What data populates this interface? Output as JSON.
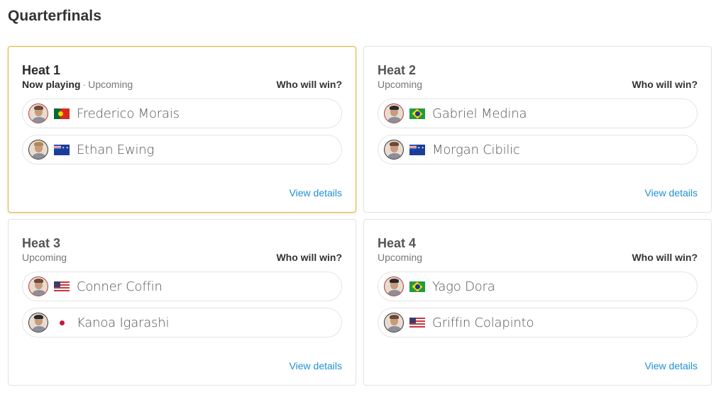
{
  "page": {
    "title": "Quarterfinals"
  },
  "who_label": "Who will win?",
  "view_details_label": "View details",
  "colors": {
    "active_border": "#e3b62e",
    "link": "#1e90d8"
  },
  "heats": [
    {
      "title": "Heat 1",
      "now_playing": "Now playing",
      "separator": "·",
      "status": "Upcoming",
      "active": true,
      "surfers": [
        {
          "name": "Frederico Morais",
          "flag": "portugal-flag-icon"
        },
        {
          "name": "Ethan Ewing",
          "flag": "australia-flag-icon"
        }
      ]
    },
    {
      "title": "Heat 2",
      "status": "Upcoming",
      "active": false,
      "surfers": [
        {
          "name": "Gabriel Medina",
          "flag": "brazil-flag-icon"
        },
        {
          "name": "Morgan Cibilic",
          "flag": "australia-flag-icon"
        }
      ]
    },
    {
      "title": "Heat 3",
      "status": "Upcoming",
      "active": false,
      "surfers": [
        {
          "name": "Conner Coffin",
          "flag": "usa-flag-icon"
        },
        {
          "name": "Kanoa Igarashi",
          "flag": "japan-flag-icon"
        }
      ]
    },
    {
      "title": "Heat 4",
      "status": "Upcoming",
      "active": false,
      "surfers": [
        {
          "name": "Yago Dora",
          "flag": "brazil-flag-icon"
        },
        {
          "name": "Griffin Colapinto",
          "flag": "usa-flag-icon"
        }
      ]
    }
  ]
}
